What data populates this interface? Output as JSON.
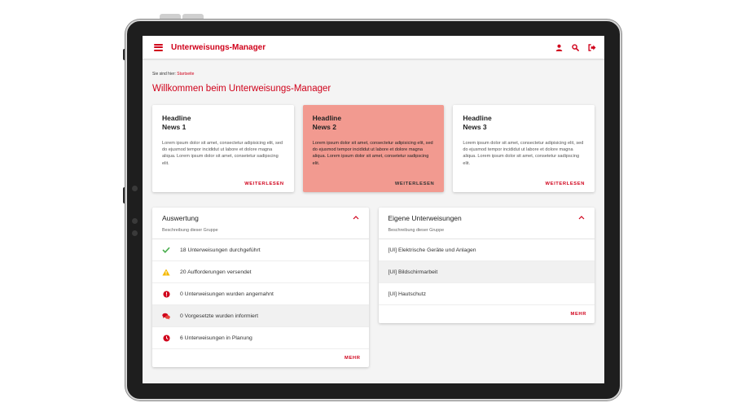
{
  "app": {
    "title": "Unterweisungs-Manager"
  },
  "icons": {
    "menu": "menu-icon",
    "user": "user-icon",
    "search": "search-icon",
    "logout": "logout-icon"
  },
  "colors": {
    "brand": "#d0021b",
    "card_highlight": "#f29a90",
    "success": "#4caf50",
    "warning": "#f5b800"
  },
  "breadcrumb": {
    "prefix": "Sie sind hier:",
    "current": "Startseite"
  },
  "page": {
    "title": "Willkommen beim Unterweisungs-Manager"
  },
  "news": [
    {
      "headline": "Headline\nNews 1",
      "text": "Lorem ipsum dolor sit amet, consectetur adipisicing elit, sed do ejusmod tempor incididut ut labore et dolore magna aliqua. Lorem ipsum dolor sit amet, consetetur sadipscing elit.",
      "more": "WEITERLESEN"
    },
    {
      "headline": "Headline\nNews 2",
      "text": "Lorem ipsum dolor sit amet, consectetur adipisicing elit, sed do ejusmod tempor incididut ut labore et dolore magna aliqua. Lorem ipsum dolor sit amet, consetetur sadipscing elit.",
      "more": "WEITERLESEN"
    },
    {
      "headline": "Headline\nNews 3",
      "text": "Lorem ipsum dolor sit amet, consectetur adipisicing elit, sed do ejusmod tempor incididut ut labore et dolore magna aliqua. Lorem ipsum dolor sit amet, consetetur sadipscing elit.",
      "more": "WEITERLESEN"
    }
  ],
  "auswertung": {
    "title": "Auswertung",
    "subtitle": "Beschreibung dieser Gruppe",
    "items": [
      {
        "icon": "check-icon",
        "text": "18 Unterweisungen durchgeführt"
      },
      {
        "icon": "warning-icon",
        "text": "20 Aufforderungen versendet"
      },
      {
        "icon": "alert-circle-icon",
        "text": "0 Unterweisungen wurden angemahnt"
      },
      {
        "icon": "chat-icon",
        "text": "0 Vorgesetzte wurden informiert"
      },
      {
        "icon": "clock-icon",
        "text": "6 Unterweisungen in Planung"
      }
    ],
    "more": "MEHR"
  },
  "eigene": {
    "title": "Eigene Unterweisungen",
    "subtitle": "Beschreibung dieser Gruppe",
    "items": [
      {
        "text": "[UI] Elektrische Geräte und Anlagen"
      },
      {
        "text": "[UI] Bildschirmarbeit"
      },
      {
        "text": "[UI] Hautschutz"
      }
    ],
    "more": "MEHR"
  }
}
